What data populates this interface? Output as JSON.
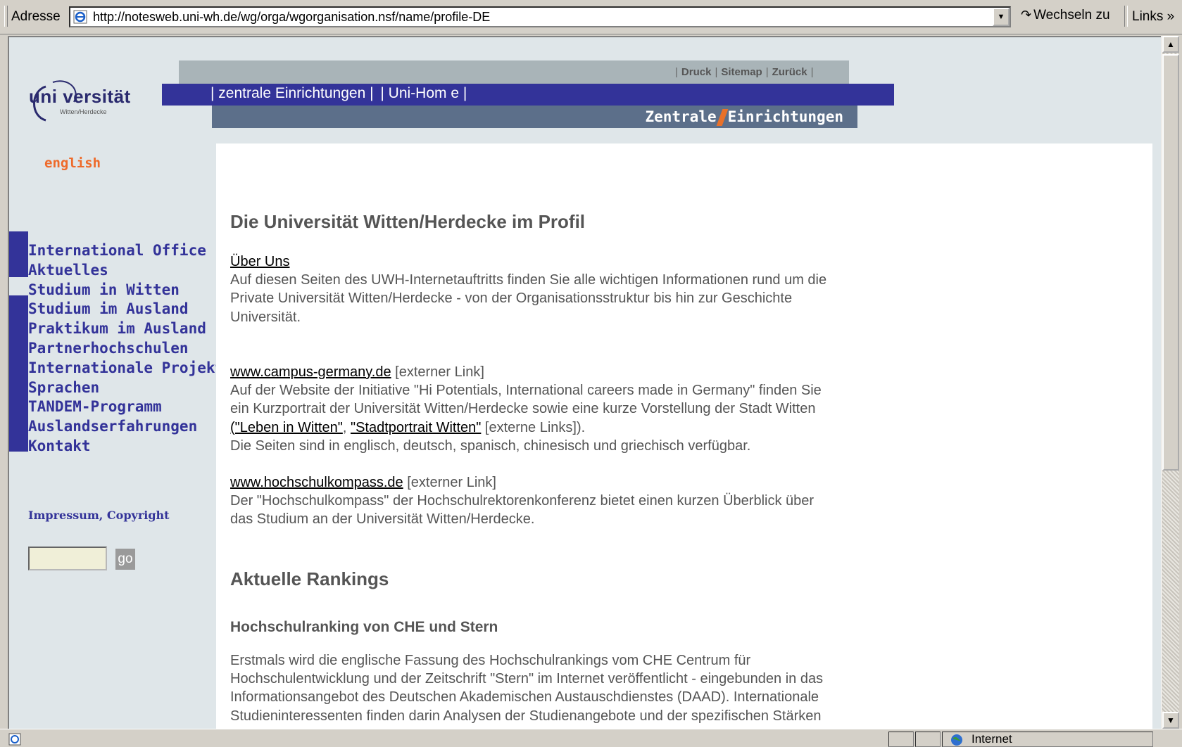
{
  "address_bar": {
    "label": "Adresse",
    "url": "http://notesweb.uni-wh.de/wg/orga/wgorganisation.nsf/name/profile-DE",
    "go_label": "Wechseln zu",
    "links_label": "Links »"
  },
  "header": {
    "logo_text": "uni versität",
    "logo_sub": "Witten/Herdecke",
    "util_links": [
      "Druck",
      "Sitemap",
      "Zurück"
    ],
    "top_nav": [
      "| zentrale Einrichtungen |",
      "| Uni-Hom e |"
    ],
    "banner_left": "Zentrale",
    "banner_right": "Einrichtungen"
  },
  "sidebar": {
    "language_link": "english",
    "nav_items": [
      "International Office",
      "Aktuelles",
      "Studium in Witten",
      "Studium im Ausland",
      "Praktikum im Ausland",
      "Partnerhochschulen",
      "Internationale Projekte",
      "Sprachen",
      "TANDEM-Programm",
      "Auslandserfahrungen",
      "Kontakt"
    ],
    "impressum": "Impressum, Copyright",
    "search_placeholder": "",
    "go_button": "go"
  },
  "content": {
    "profile_heading": "Die Universität Witten/Herdecke im Profil",
    "ueber_uns": {
      "link": "Über Uns",
      "lines": [
        "Auf diesen Seiten des UWH-Internetauftritts finden Sie alle wichtigen Informationen rund um die",
        "Private Universität Witten/Herdecke - von der Organisationsstruktur bis hin zur Geschichte",
        "Universität."
      ]
    },
    "campus": {
      "link": "www.campus-germany.de",
      "tag": " [externer Link]",
      "line1": "Auf der Website der Initiative \"Hi Potentials, International careers made in Germany\" finden Sie",
      "line2": "ein Kurzportrait der Universität Witten/Herdecke sowie eine kurze Vorstellung der Stadt Witten",
      "link_leben": "(\"Leben in Witten\"",
      "comma": ", ",
      "link_stadt": "\"Stadtportrait Witten\"",
      "tail": " [externe Links]).",
      "line4": "Die Seiten sind in englisch, deutsch, spanisch, chinesisch und griechisch verfügbar."
    },
    "hochschulkompass": {
      "link": "www.hochschulkompass.de",
      "tag": " [externer Link]",
      "lines": [
        "Der \"Hochschulkompass\" der Hochschulrektorenkonferenz bietet einen kurzen Überblick über",
        "das Studium an der Universität Witten/Herdecke."
      ]
    },
    "rankings_heading": "Aktuelle Rankings",
    "ranking_subheading": "Hochschulranking von CHE und Stern",
    "ranking_lines": [
      "Erstmals wird die englische Fassung des Hochschulrankings vom CHE Centrum für",
      "Hochschulentwicklung und der Zeitschrift \"Stern\" im Internet veröffentlicht - eingebunden in das",
      "Informationsangebot des Deutschen Akademischen Austauschdienstes (DAAD). Internationale",
      "Studieninteressenten finden darin Analysen der Studienangebote und der spezifischen Stärken"
    ]
  },
  "status_bar": {
    "zone": "Internet"
  },
  "colors": {
    "nav_blue": "#333399",
    "accent_orange": "#ee6a2a",
    "page_bg": "#dfe6e9",
    "text_grey": "#555555"
  }
}
